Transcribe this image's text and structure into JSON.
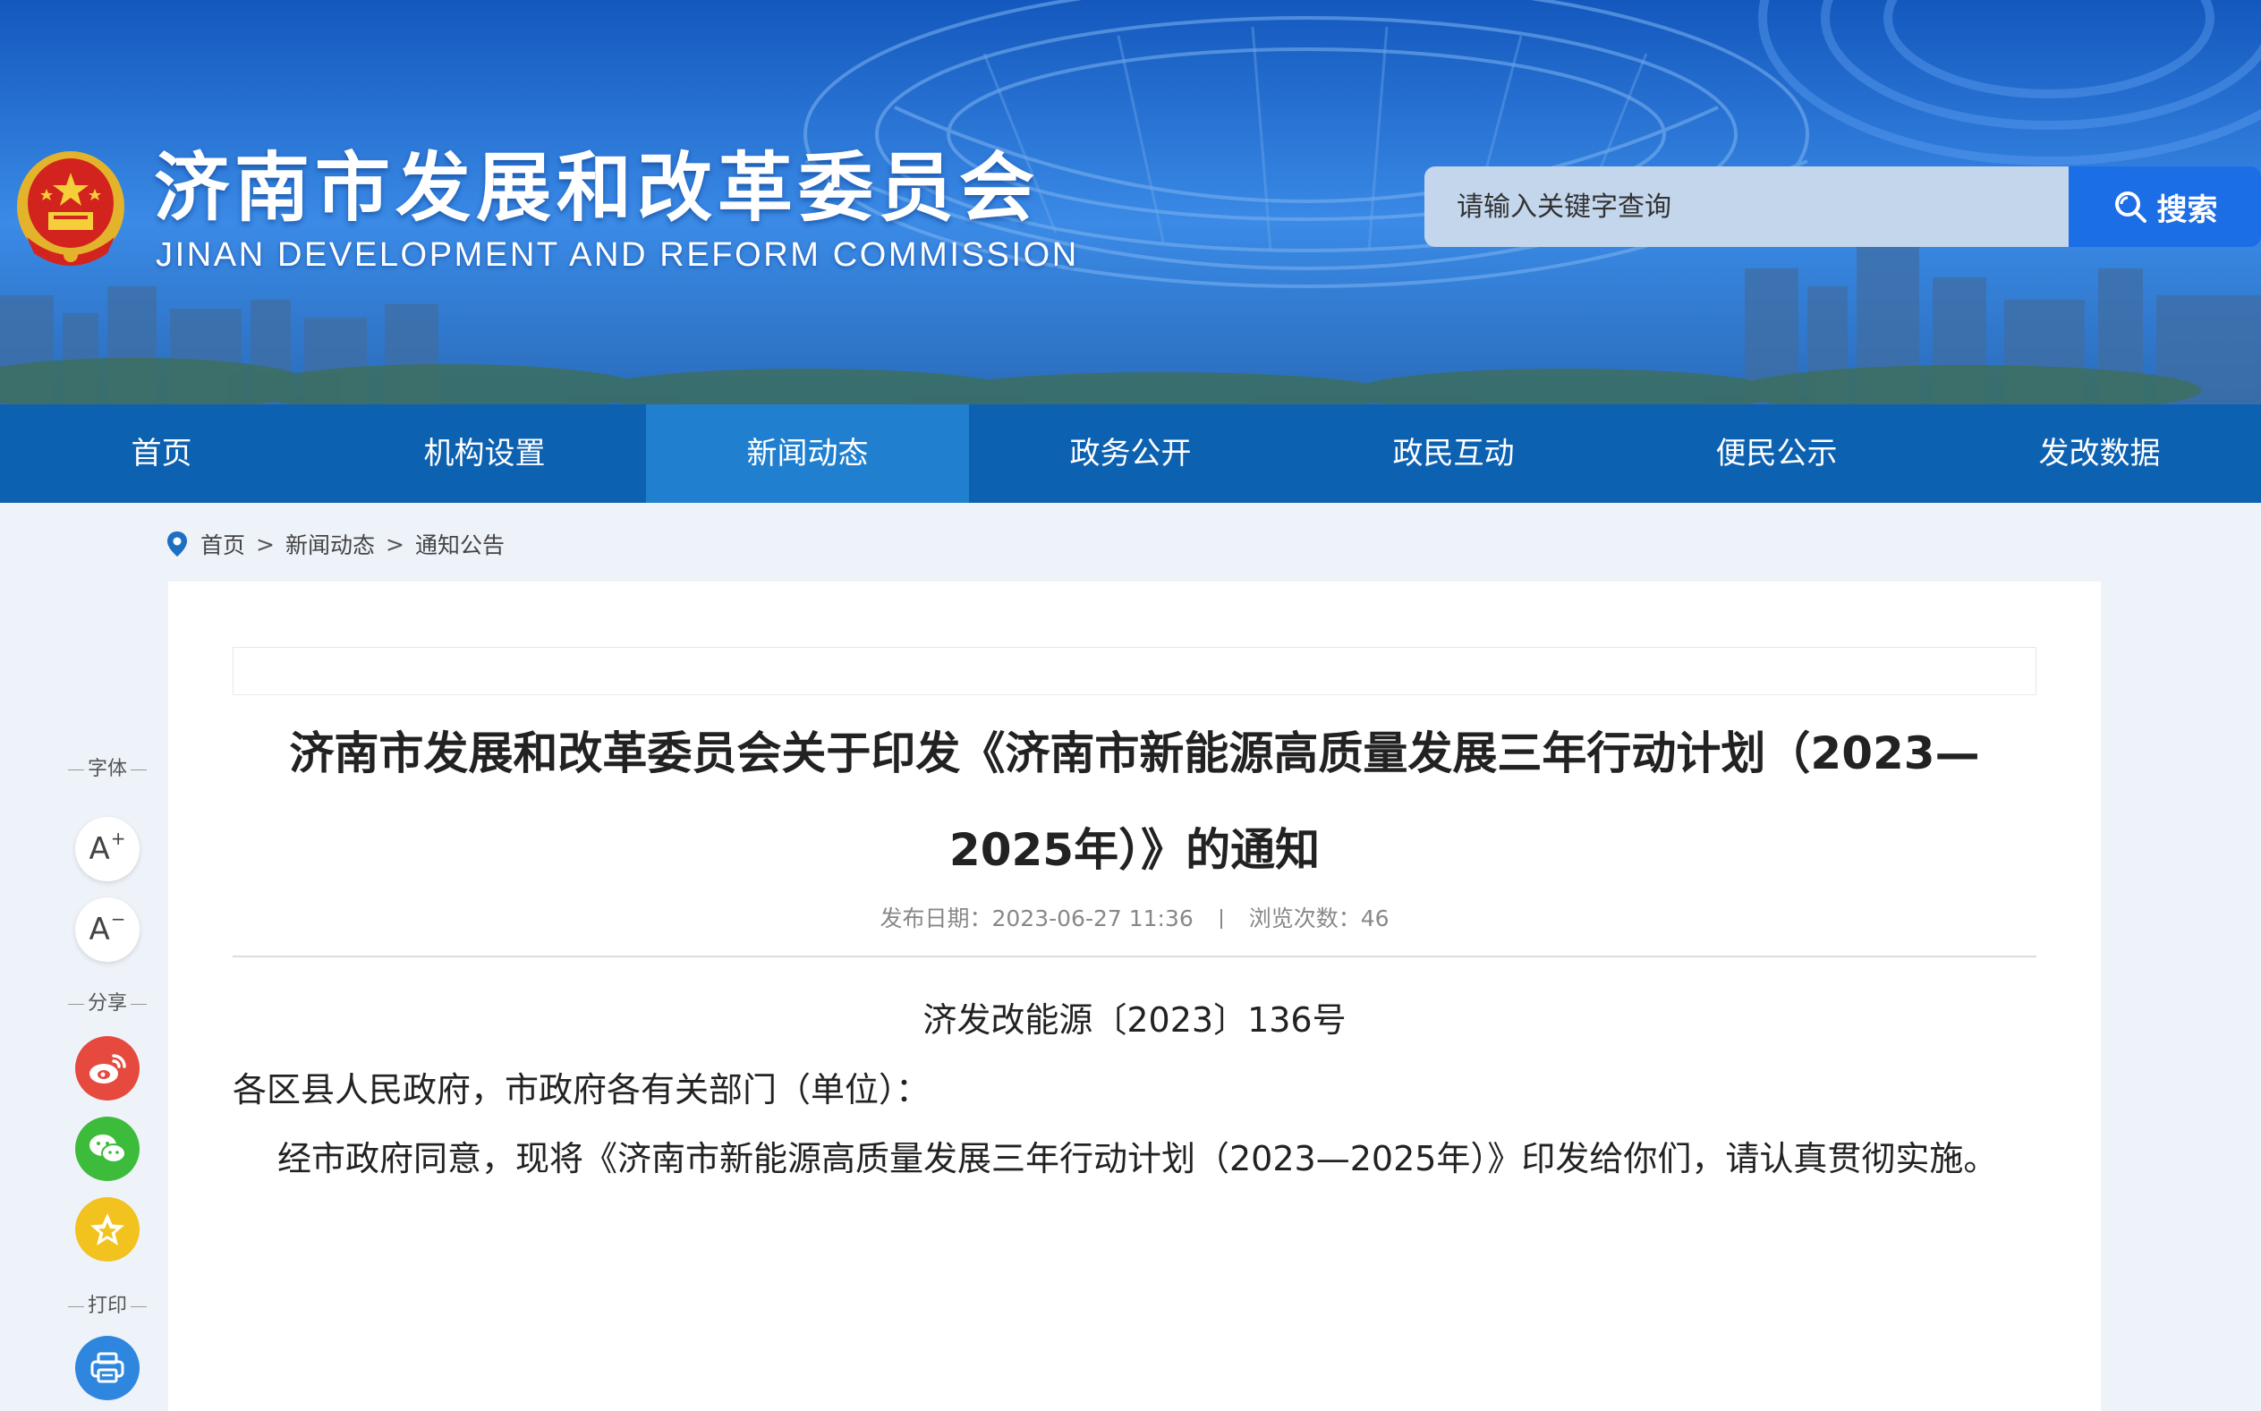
{
  "header": {
    "site_title": "济南市发展和改革委员会",
    "site_subtitle": "JINAN DEVELOPMENT AND REFORM COMMISSION",
    "emblem_icon": "national-emblem-icon",
    "search_placeholder": "请输入关键字查询",
    "search_button_label": "搜索"
  },
  "nav": {
    "items": [
      {
        "label": "首页",
        "active": false
      },
      {
        "label": "机构设置",
        "active": false
      },
      {
        "label": "新闻动态",
        "active": true
      },
      {
        "label": "政务公开",
        "active": false
      },
      {
        "label": "政民互动",
        "active": false
      },
      {
        "label": "便民公示",
        "active": false
      },
      {
        "label": "发改数据",
        "active": false
      }
    ]
  },
  "breadcrumb": {
    "icon": "location-pin-icon",
    "items": [
      "首页",
      "新闻动态",
      "通知公告"
    ],
    "separator": ">"
  },
  "tools": {
    "font_label": "字体",
    "font_increase_label": "A",
    "font_increase_sup": "+",
    "font_decrease_label": "A",
    "font_decrease_sup": "−",
    "share_label": "分享",
    "print_label": "打印"
  },
  "article": {
    "title_line1": "济南市发展和改革委员会关于印发《济南市新能源高质量发展三年行动计划（2023—",
    "title_line2": "2025年）》的通知",
    "publish_date_label": "发布日期：",
    "publish_date": "2023-06-27 11:36",
    "views_label": "浏览次数：",
    "views": "46",
    "doc_number": "济发改能源〔2023〕136号",
    "addressee": "各区县人民政府，市政府各有关部门（单位）：",
    "body": "经市政府同意，现将《济南市新能源高质量发展三年行动计划（2023—2025年）》印发给你们，请认真贯彻实施。"
  },
  "colors": {
    "nav_bg": "#0d61b1",
    "nav_active": "#2080cf",
    "search_button": "#1c6ee6",
    "weibo": "#e6493e",
    "wechat": "#3dbb3a",
    "favorite": "#f2c21f",
    "print": "#2f86de"
  }
}
